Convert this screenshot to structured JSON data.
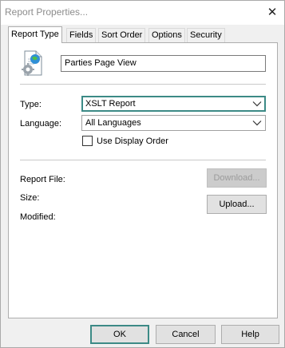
{
  "window": {
    "title": "Report Properties..."
  },
  "tabs": [
    {
      "label": "Report Type",
      "active": true
    },
    {
      "label": "Fields",
      "active": false
    },
    {
      "label": "Sort Order",
      "active": false
    },
    {
      "label": "Options",
      "active": false
    },
    {
      "label": "Security",
      "active": false
    }
  ],
  "report": {
    "icon": "report-document-icon",
    "name_value": "Parties Page View"
  },
  "type": {
    "label": "Type:",
    "value": "XSLT Report"
  },
  "language": {
    "label": "Language:",
    "value": "All Languages"
  },
  "use_display_order": {
    "label": "Use Display Order",
    "checked": false
  },
  "file_info": {
    "report_file_label": "Report File:",
    "size_label": "Size:",
    "modified_label": "Modified:",
    "download_label": "Download...",
    "upload_label": "Upload..."
  },
  "footer": {
    "ok_label": "OK",
    "cancel_label": "Cancel",
    "help_label": "Help"
  },
  "colors": {
    "accent": "#3c8a86",
    "title_text": "#8c8c8c"
  }
}
